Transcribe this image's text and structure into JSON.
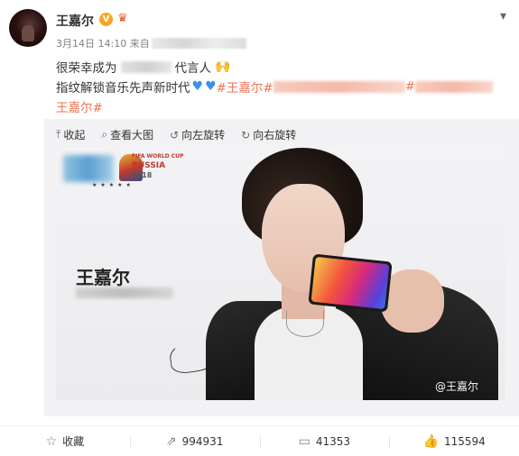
{
  "post": {
    "username": "王嘉尔",
    "verified_badge": "V",
    "timestamp": "3月14日 14:10 来自",
    "line1_start": "很荣幸成为",
    "line1_end": "代言人",
    "line2_start": "指纹解锁音乐先声新时代",
    "tag1": "#王嘉尔#",
    "tag_end": "#",
    "line3": "王嘉尔#"
  },
  "media_toolbar": {
    "collapse": "收起",
    "view_large": "查看大图",
    "rotate_left": "向左旋转",
    "rotate_right": "向右旋转"
  },
  "photo": {
    "name": "王嘉尔",
    "fifa_small": "FIFA WORLD CUP",
    "russia": "RUSSIA",
    "year": "2018",
    "stars": "★★★★★",
    "watermark": "@王嘉尔"
  },
  "actions": {
    "favorite": "收藏",
    "repost_count": "994931",
    "comment_count": "41353",
    "like_count": "115594"
  },
  "icons": {
    "collapse": "arrow-up-icon",
    "view_large": "search-icon",
    "rotate_left": "rotate-left-icon",
    "rotate_right": "rotate-right-icon",
    "favorite": "star-icon",
    "repost": "share-icon",
    "comment": "comment-icon",
    "like": "thumbs-up-icon"
  },
  "colors": {
    "tag": "#eb7350",
    "heart": "#3a8ff0",
    "verified": "#f6a623"
  }
}
